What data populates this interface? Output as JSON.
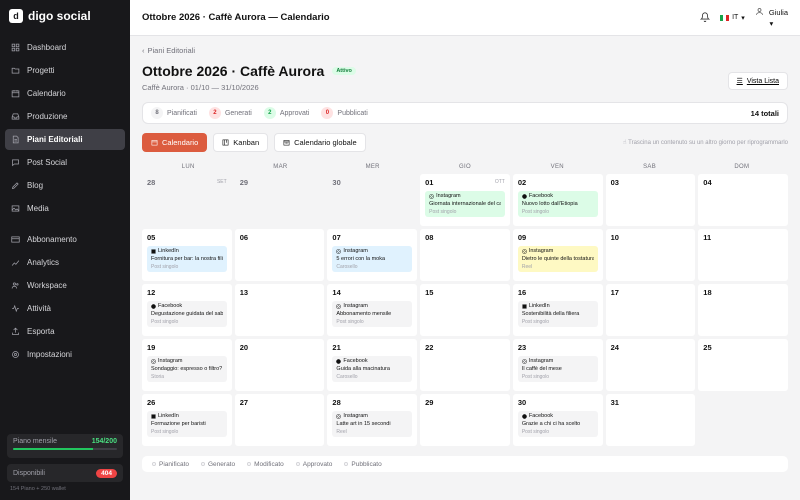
{
  "brand": {
    "name": "digo social"
  },
  "sidebar": {
    "items_top": [
      {
        "label": "Dashboard",
        "icon": "grid-icon"
      },
      {
        "label": "Progetti",
        "icon": "folder-icon"
      },
      {
        "label": "Calendario",
        "icon": "calendar-icon"
      },
      {
        "label": "Produzione",
        "icon": "inbox-icon"
      },
      {
        "label": "Piani Editoriali",
        "icon": "document-icon",
        "active": true
      },
      {
        "label": "Post Social",
        "icon": "chat-icon"
      },
      {
        "label": "Blog",
        "icon": "pen-icon"
      },
      {
        "label": "Media",
        "icon": "image-icon"
      }
    ],
    "items_bottom": [
      {
        "label": "Abbonamento",
        "icon": "card-icon"
      },
      {
        "label": "Analytics",
        "icon": "chart-icon"
      },
      {
        "label": "Workspace",
        "icon": "users-icon"
      },
      {
        "label": "Attività",
        "icon": "activity-icon"
      },
      {
        "label": "Esporta",
        "icon": "export-icon"
      },
      {
        "label": "Impostazioni",
        "icon": "gear-icon"
      }
    ],
    "plan": {
      "label": "Piano mensile",
      "value": "154/200",
      "used_fraction": 0.77
    },
    "available": {
      "label": "Disponibili",
      "value": "404"
    },
    "footer": "154 Piano + 250 wallet"
  },
  "topbar": {
    "title": "Ottobre 2026 · Caffè Aurora — Calendario",
    "lang": "IT",
    "user": "Giulia"
  },
  "page": {
    "breadcrumb": "Piani Editoriali",
    "title": "Ottobre 2026 · Caffè Aurora",
    "badge": "Attivo",
    "subtitle": "Caffè Aurora · 01/10 — 31/10/2026",
    "list_button": "Vista Lista"
  },
  "statuses": [
    {
      "count": "8",
      "label": "Pianificati",
      "bg": "#f4f4f5",
      "fg": "#71717a"
    },
    {
      "count": "2",
      "label": "Generati",
      "bg": "#fee2e2",
      "fg": "#dc2626"
    },
    {
      "count": "2",
      "label": "Approvati",
      "bg": "#dcfce7",
      "fg": "#16a34a"
    },
    {
      "count": "0",
      "label": "Pubblicati",
      "bg": "#fee2e2",
      "fg": "#dc2626"
    }
  ],
  "total": "14 totali",
  "views": [
    {
      "label": "Calendario",
      "active": true
    },
    {
      "label": "Kanban",
      "active": false
    },
    {
      "label": "Calendario globale",
      "active": false
    }
  ],
  "hint": "Trascina un contenuto su un altro giorno per riprogrammarlo",
  "weekdays": [
    "LUN",
    "MAR",
    "MER",
    "GIO",
    "VEN",
    "SAB",
    "DOM"
  ],
  "calendar": [
    {
      "day": "28",
      "mon": "SET",
      "out": true
    },
    {
      "day": "29",
      "out": true
    },
    {
      "day": "30",
      "out": true
    },
    {
      "day": "01",
      "mon": "OTT",
      "ev": {
        "net": "Instagram",
        "title": "Giornata internazionale del caffè",
        "type": "Post singolo",
        "color": "green"
      }
    },
    {
      "day": "02",
      "ev": {
        "net": "Facebook",
        "title": "Nuovo lotto dall'Etiopia",
        "type": "Post singolo",
        "color": "green"
      }
    },
    {
      "day": "03"
    },
    {
      "day": "04"
    },
    {
      "day": "05",
      "ev": {
        "net": "LinkedIn",
        "title": "Fornitura per bar: la nostra filiera",
        "type": "Post singolo",
        "color": "blue"
      }
    },
    {
      "day": "06"
    },
    {
      "day": "07",
      "ev": {
        "net": "Instagram",
        "title": "5 errori con la moka",
        "type": "Carosello",
        "color": "blue"
      }
    },
    {
      "day": "08"
    },
    {
      "day": "09",
      "ev": {
        "net": "Instagram",
        "title": "Dietro le quinte della tostatura",
        "type": "Reel",
        "color": "yellow"
      }
    },
    {
      "day": "10"
    },
    {
      "day": "11"
    },
    {
      "day": "12",
      "ev": {
        "net": "Facebook",
        "title": "Degustazione guidata del sabato",
        "type": "Post singolo",
        "color": "gray"
      }
    },
    {
      "day": "13"
    },
    {
      "day": "14",
      "ev": {
        "net": "Instagram",
        "title": "Abbonamento mensile",
        "type": "Post singolo",
        "color": "gray"
      }
    },
    {
      "day": "15"
    },
    {
      "day": "16",
      "ev": {
        "net": "LinkedIn",
        "title": "Sostenibilità della filiera",
        "type": "Post singolo",
        "color": "gray"
      }
    },
    {
      "day": "17"
    },
    {
      "day": "18"
    },
    {
      "day": "19",
      "ev": {
        "net": "Instagram",
        "title": "Sondaggio: espresso o filtro?",
        "type": "Storia",
        "color": "gray"
      }
    },
    {
      "day": "20"
    },
    {
      "day": "21",
      "ev": {
        "net": "Facebook",
        "title": "Guida alla macinatura",
        "type": "Carosello",
        "color": "gray"
      }
    },
    {
      "day": "22"
    },
    {
      "day": "23",
      "ev": {
        "net": "Instagram",
        "title": "Il caffè del mese",
        "type": "Post singolo",
        "color": "gray"
      }
    },
    {
      "day": "24"
    },
    {
      "day": "25"
    },
    {
      "day": "26",
      "ev": {
        "net": "LinkedIn",
        "title": "Formazione per baristi",
        "type": "Post singolo",
        "color": "gray"
      }
    },
    {
      "day": "27"
    },
    {
      "day": "28",
      "ev": {
        "net": "Instagram",
        "title": "Latte art in 15 secondi",
        "type": "Reel",
        "color": "gray"
      }
    },
    {
      "day": "29"
    },
    {
      "day": "30",
      "ev": {
        "net": "Facebook",
        "title": "Grazie a chi ci ha scelto",
        "type": "Post singolo",
        "color": "gray"
      }
    },
    {
      "day": "31"
    },
    {
      "empty": true
    }
  ],
  "legend": [
    "Pianificato",
    "Generato",
    "Modificato",
    "Approvato",
    "Pubblicato"
  ]
}
